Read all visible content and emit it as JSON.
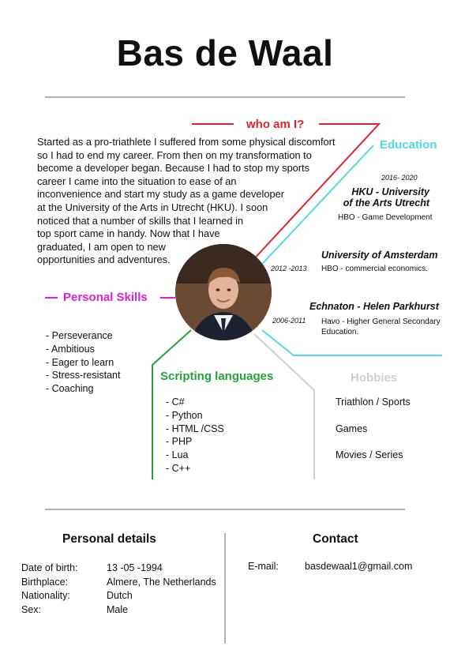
{
  "name": "Bas de Waal",
  "sections": {
    "who": "who am I?",
    "education": "Education",
    "personal_skills": "Personal Skills",
    "scripting": "Scripting languages",
    "hobbies": "Hobbies"
  },
  "intro_lines": [
    "Started as a pro-triathlete I suffered from some physical discomfort",
    "so I had to end my career. From then on my transformation to",
    "become a developer began. Because I had to stop my sports",
    "career I came into the situation to ease of an",
    "inconvenience and start my study as a game developer",
    "at the University of the Arts in Utrecht (HKU). I soon",
    "noticed that a number of skills that I learned in",
    "top sport came in handy. Now that I have",
    "graduated, I am open to new",
    "opportunities and adventures."
  ],
  "education": [
    {
      "year": "2016- 2020",
      "title_1": "HKU - University",
      "title_2": "of the Arts Utrecht",
      "detail_1": "HBO - Game Development",
      "detail_2": ""
    },
    {
      "year": "2012 -2013",
      "title_1": "University of Amsterdam",
      "title_2": "",
      "detail_1": "HBO - commercial economics.",
      "detail_2": ""
    },
    {
      "year": "2006-2011",
      "title_1": "Echnaton - Helen Parkhurst",
      "title_2": "",
      "detail_1": "Havo - Higher General Secondary",
      "detail_2": "Education."
    }
  ],
  "skills": [
    "- Perseverance",
    "- Ambitious",
    "- Eager to learn",
    "- Stress-resistant",
    "- Coaching"
  ],
  "languages": [
    "- C#",
    "- Python",
    "- HTML /CSS",
    "- PHP",
    "- Lua",
    "- C++"
  ],
  "hobbies": [
    "Triathlon / Sports",
    "Games",
    "Movies / Series"
  ],
  "personal_details": {
    "title": "Personal details",
    "rows": [
      {
        "label": "Date of birth:",
        "value": "13 -05 -1994"
      },
      {
        "label": "Birthplace:",
        "value": "Almere, The Netherlands"
      },
      {
        "label": "Nationality:",
        "value": "Dutch"
      },
      {
        "label": "Sex:",
        "value": "Male"
      }
    ]
  },
  "contact": {
    "title": "Contact",
    "email_label": "E-mail:",
    "email": "basdewaal1@gmail.com"
  },
  "colors": {
    "red": "#e0252c",
    "cyan": "#4fd9ea",
    "magenta": "#e020d6",
    "green": "#22a63a",
    "gray": "#cfcfcf"
  }
}
